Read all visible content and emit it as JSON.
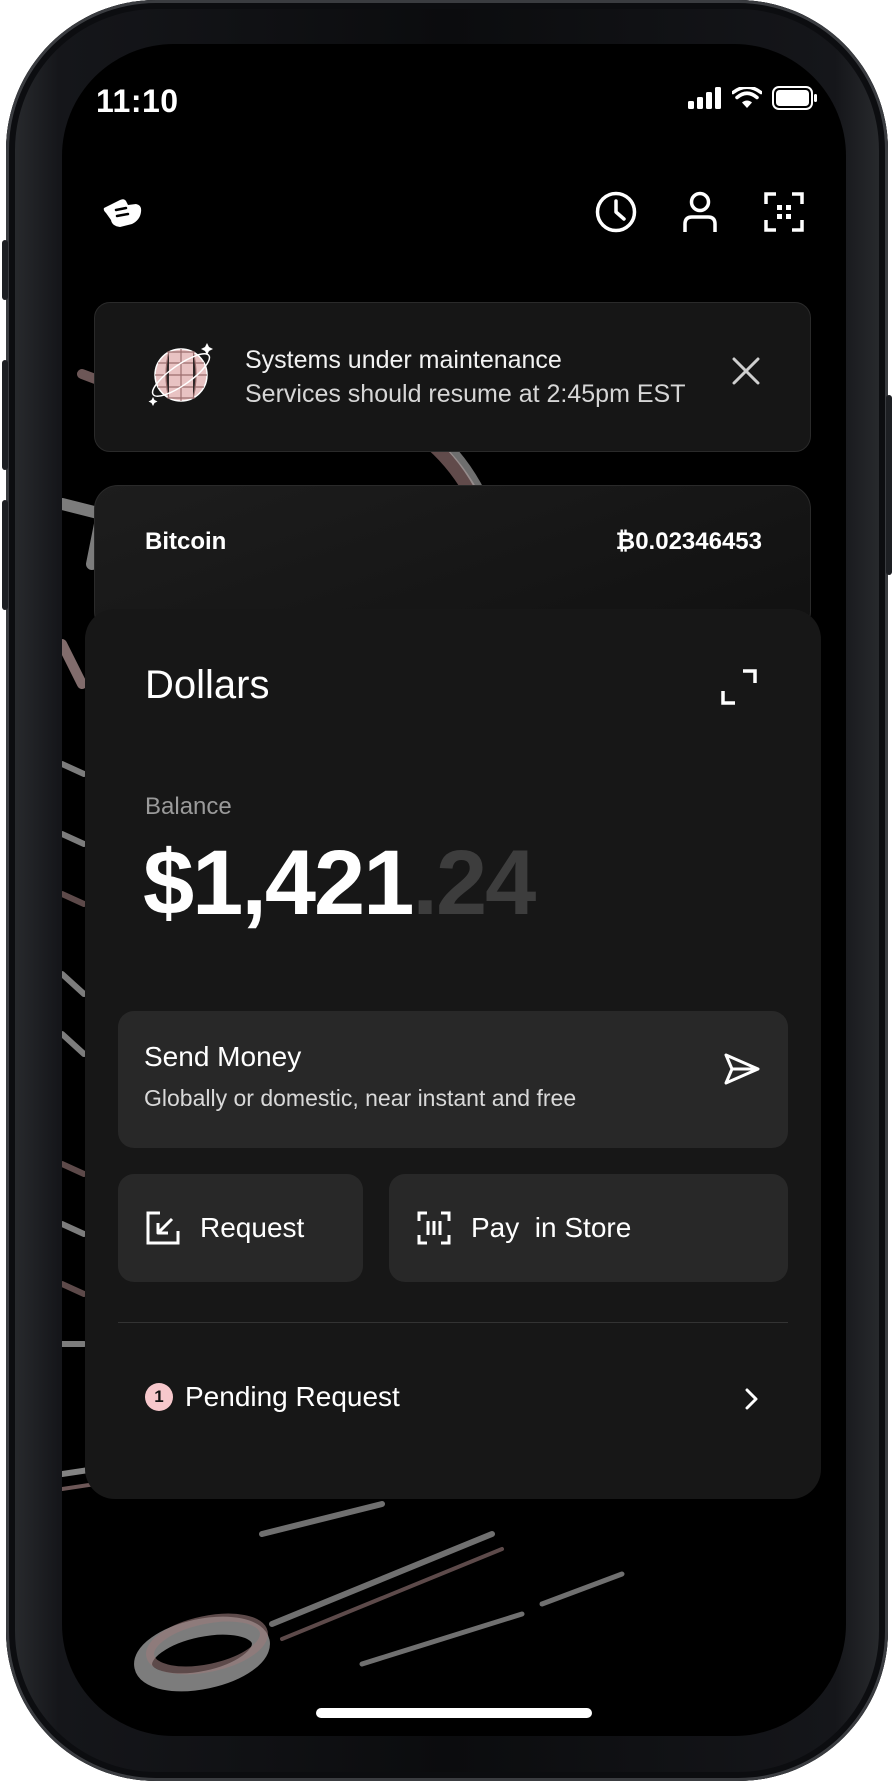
{
  "status_bar": {
    "time": "11:10"
  },
  "topbar": {
    "logo_icon": "hand-point-logo",
    "icons": [
      "history-clock-icon",
      "profile-person-icon",
      "qr-scan-icon"
    ]
  },
  "banner": {
    "title": "Systems under maintenance",
    "subtitle": "Services should resume at 2:45pm EST",
    "icon": "disco-ball-icon"
  },
  "bitcoin_card": {
    "label": "Bitcoin",
    "value": "₿0.02346453"
  },
  "dollars_card": {
    "title": "Dollars",
    "balance_label": "Balance",
    "amount_whole": "$1,421",
    "amount_cents": ".24",
    "send": {
      "title": "Send Money",
      "subtitle": "Globally or domestic, near instant and free"
    },
    "request_label": "Request",
    "pay_label": "Pay  in Store",
    "pending": {
      "count": "1",
      "label": "Pending Request"
    }
  },
  "colors": {
    "background": "#000000",
    "card": "#171717",
    "button": "#282828",
    "badge": "#f7c8cc",
    "muted_cents": "#3d3d3d"
  }
}
